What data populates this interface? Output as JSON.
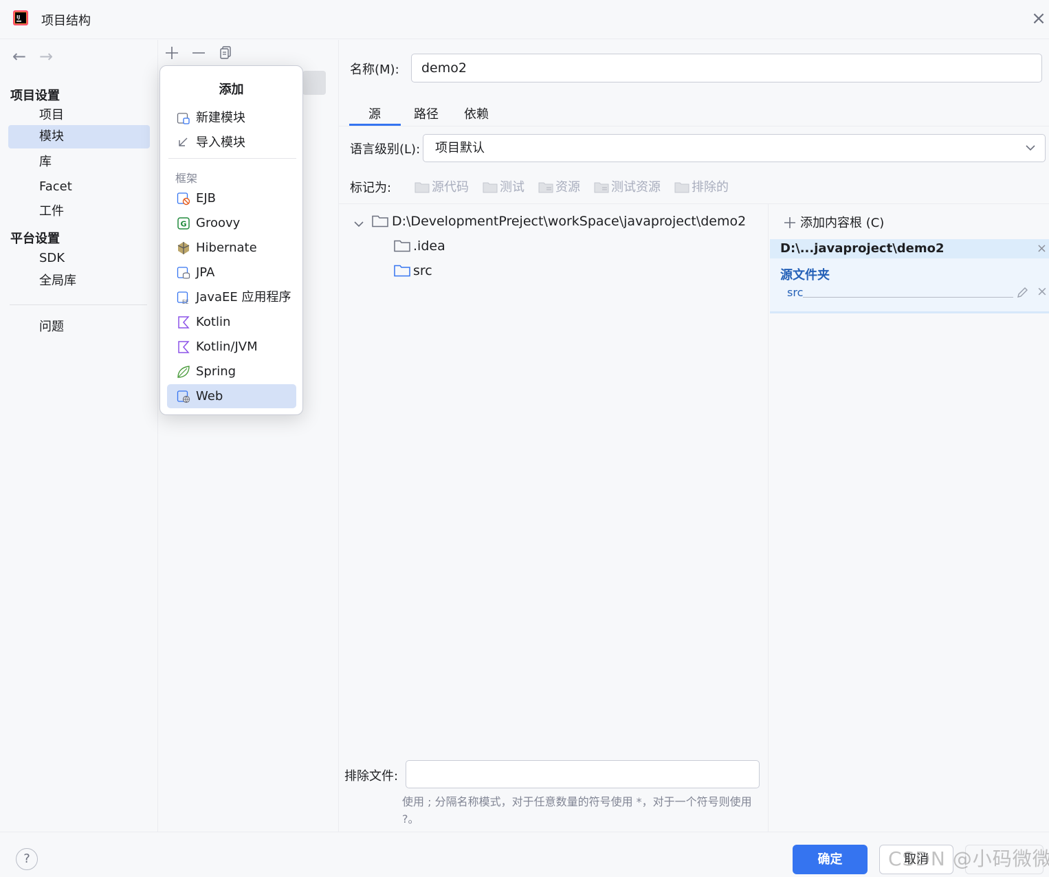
{
  "window": {
    "title": "项目结构",
    "close_icon": "close-icon"
  },
  "nav": {
    "back_icon": "arrow-left-icon",
    "forward_icon": "arrow-right-icon"
  },
  "sidebar": {
    "project_settings_header": "项目设置",
    "project_settings_items": [
      "项目",
      "模块",
      "库",
      "Facet",
      "工件"
    ],
    "platform_settings_header": "平台设置",
    "platform_settings_items": [
      "SDK",
      "全局库"
    ],
    "problems": "问题",
    "selected": "模块"
  },
  "toolbar": {
    "add_icon": "plus-icon",
    "remove_icon": "minus-icon",
    "copy_icon": "copy-icon"
  },
  "add_popup": {
    "title": "添加",
    "module_items": [
      "新建模块",
      "导入模块"
    ],
    "framework_header": "框架",
    "framework_items": [
      "EJB",
      "Groovy",
      "Hibernate",
      "JPA",
      "JavaEE 应用程序",
      "Kotlin",
      "Kotlin/JVM",
      "Spring",
      "Web"
    ],
    "selected": "Web"
  },
  "editor": {
    "name_label": "名称(M):",
    "name_value": "demo2",
    "tabs": [
      "源",
      "路径",
      "依赖"
    ],
    "active_tab": "源",
    "language_level_label": "语言级别(L):",
    "language_level_value": "项目默认",
    "mark_as_label": "标记为:",
    "mark_as_buttons": [
      "源代码",
      "测试",
      "资源",
      "测试资源",
      "排除的"
    ]
  },
  "tree": {
    "root": "D:\\DevelopmentPreject\\workSpace\\javaproject\\demo2",
    "children": [
      ".idea",
      "src"
    ]
  },
  "content_root": {
    "add_label": "添加内容根 (C)",
    "root_path": "D:\\...javaproject\\demo2",
    "source_folders_label": "源文件夹",
    "source_folders": [
      "src"
    ]
  },
  "exclude": {
    "label": "排除文件:",
    "value": "",
    "hint": "使用 ; 分隔名称模式，对于任意数量的符号使用 *，对于一个符号则使用 ?。"
  },
  "buttons": {
    "help": "?",
    "ok": "确定",
    "cancel": "取消"
  },
  "watermark": "CSDN @小码微微",
  "colors": {
    "accent": "#3574f0",
    "selection": "#d5e1f7",
    "content_root_bg": "#dcecfb",
    "source_folder_text": "#2561b8"
  }
}
